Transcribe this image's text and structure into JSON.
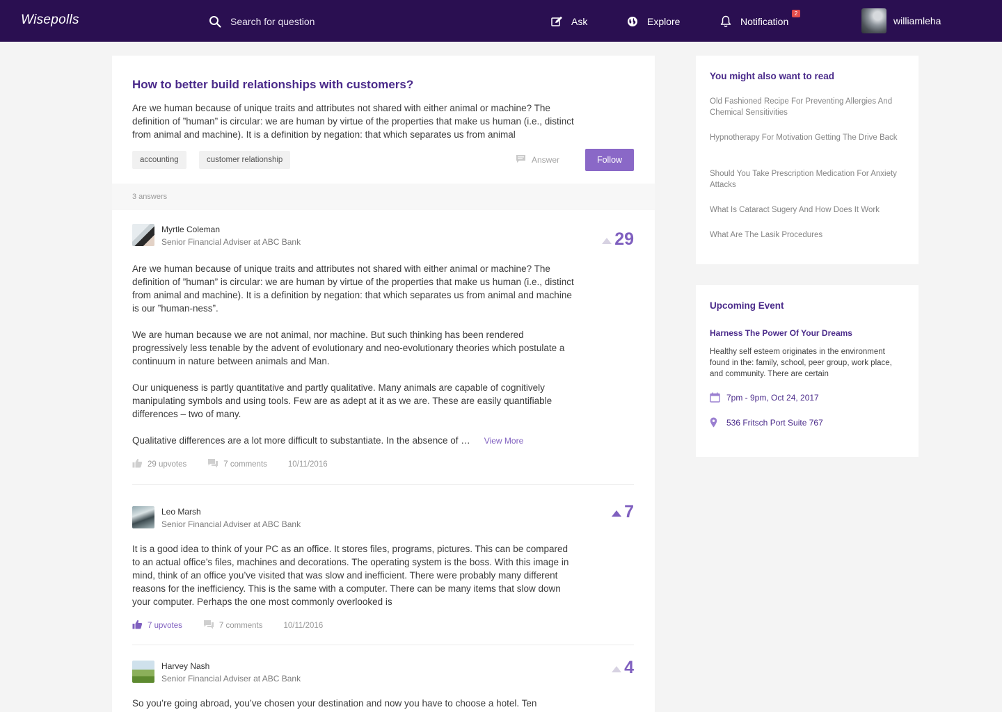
{
  "header": {
    "brand": "Wisepolls",
    "search_placeholder": "Search for question",
    "nav": {
      "ask": "Ask",
      "explore": "Explore",
      "notification": "Notification"
    },
    "notification_count": "2",
    "username": "williamleha"
  },
  "question": {
    "title": "How to better build relationships with customers?",
    "body": "Are we human because of unique traits and attributes not shared with either animal or machine? The definition of ”human” is circular: we are human by virtue of the properties that make us human (i.e., distinct from animal and machine). It is a definition by negation: that which separates us from animal",
    "tags": [
      "accounting",
      "customer relationship"
    ],
    "answer_label": "Answer",
    "follow_label": "Follow"
  },
  "answers_count": "3 answers",
  "answers": [
    {
      "name": "Myrtle Coleman",
      "role": "Senior Financial Adviser at ABC Bank",
      "votes": "29",
      "paragraphs": [
        "Are we human because of unique traits and attributes not shared with either animal or machine? The definition of ”human” is circular: we are human by virtue of the properties that make us human (i.e., distinct from animal and machine). It is a definition by negation: that which separates us from animal and machine is our ”human-ness”.",
        "We are human because we are not animal, nor machine. But such thinking has been rendered progressively less tenable by the advent of evolutionary and neo-evolutionary theories which postulate a continuum in nature between animals and Man.",
        "Our uniqueness is partly quantitative and partly qualitative. Many animals are capable of cognitively manipulating symbols and using tools. Few are as adept at it as we are. These are easily quantifiable differences – two of many.",
        "Qualitative differences are a lot more difficult to substantiate. In the absence of …"
      ],
      "view_more": "View More",
      "upvotes": "29 upvotes",
      "comments": "7 comments",
      "date": "10/11/2016"
    },
    {
      "name": "Leo Marsh",
      "role": "Senior Financial Adviser at ABC Bank",
      "votes": "7",
      "body": "It is a good idea to think of your PC as an office. It stores files, programs, pictures. This can be compared to an actual office’s files, machines and decorations. The operating system is the boss. With this image in mind, think of an office you’ve visited that was slow and inefficient. There were probably many different reasons for the inefficiency. This is the same with a computer.  There can be many items that slow down your computer. Perhaps the one most commonly overlooked is",
      "upvotes": "7 upvotes",
      "comments": "7 comments",
      "date": "10/11/2016"
    },
    {
      "name": "Harvey Nash",
      "role": "Senior Financial Adviser at ABC Bank",
      "votes": "4",
      "body": "So you’re going abroad, you’ve chosen your destination and now you have to choose a hotel. Ten"
    }
  ],
  "sidebar": {
    "read_title": "You might also want to read",
    "read_items": [
      "Old Fashioned Recipe For Preventing Allergies And Chemical Sensitivities",
      "Hypnotherapy For Motivation Getting The Drive Back",
      "Should You Take Prescription Medication For Anxiety Attacks",
      "What Is Cataract Sugery And How Does It Work",
      "What Are The Lasik Procedures"
    ],
    "event_title": "Upcoming Event",
    "event_name": "Harness The Power Of Your Dreams",
    "event_desc": "Healthy self esteem originates in the environment found in the: family, school, peer group, work place, and community. There are certain",
    "event_time": "7pm - 9pm, Oct 24, 2017",
    "event_location": "536 Fritsch Port Suite 767"
  },
  "colors": {
    "header_bg": "#2a0f51",
    "accent": "#7f5fbf",
    "title": "#4a2a8a",
    "follow_button": "#8a68c7",
    "badge": "#e24b4b"
  },
  "icons": [
    "search-icon",
    "edit-icon",
    "globe-icon",
    "bell-icon",
    "comment-icon",
    "upvote-arrow-icon",
    "thumbs-up-icon",
    "calendar-icon",
    "location-pin-icon"
  ]
}
